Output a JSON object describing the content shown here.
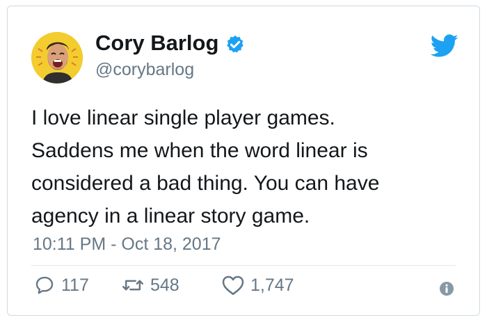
{
  "tweet": {
    "author": {
      "display_name": "Cory Barlog",
      "handle": "@corybarlog",
      "verified": true,
      "avatar": "avatar-icon"
    },
    "text_lines": [
      "I love linear single player games.",
      "Saddens me when the word linear is",
      "considered a bad thing. You can have",
      "agency in a linear story game."
    ],
    "timestamp": "10:11 PM - Oct 18, 2017",
    "actions": {
      "replies": "117",
      "retweets": "548",
      "likes": "1,747"
    },
    "icons": {
      "brand": "twitter-bird-icon",
      "verified": "verified-badge-icon",
      "reply": "reply-icon",
      "retweet": "retweet-icon",
      "like": "heart-icon",
      "info": "info-icon"
    }
  },
  "colors": {
    "twitter_blue": "#1da1f2",
    "text_primary": "#14171a",
    "text_secondary": "#657786",
    "border": "#cfd9de",
    "avatar_bg": "#f3cc2f"
  }
}
